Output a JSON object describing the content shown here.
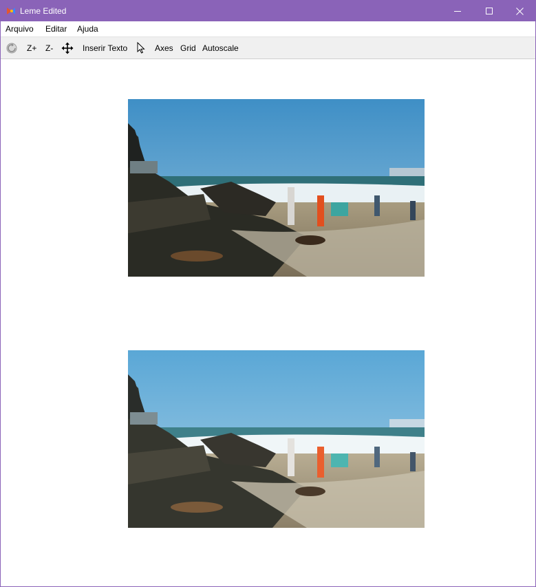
{
  "window": {
    "title": "Leme Edited"
  },
  "menu": {
    "items": [
      "Arquivo",
      "Editar",
      "Ajuda"
    ]
  },
  "toolbar": {
    "zoom_in": "Z+",
    "zoom_out": "Z-",
    "insert_text": "Inserir Texto",
    "axes": "Axes",
    "grid": "Grid",
    "autoscale": "Autoscale",
    "icons": [
      "reset-icon",
      "move-icon",
      "pointer-icon"
    ]
  },
  "colors": {
    "titlebar": "#8a63b8",
    "toolbar_bg": "#f0f0f0"
  },
  "canvas": {
    "images": [
      "beach-photo-original",
      "beach-photo-edited"
    ]
  }
}
